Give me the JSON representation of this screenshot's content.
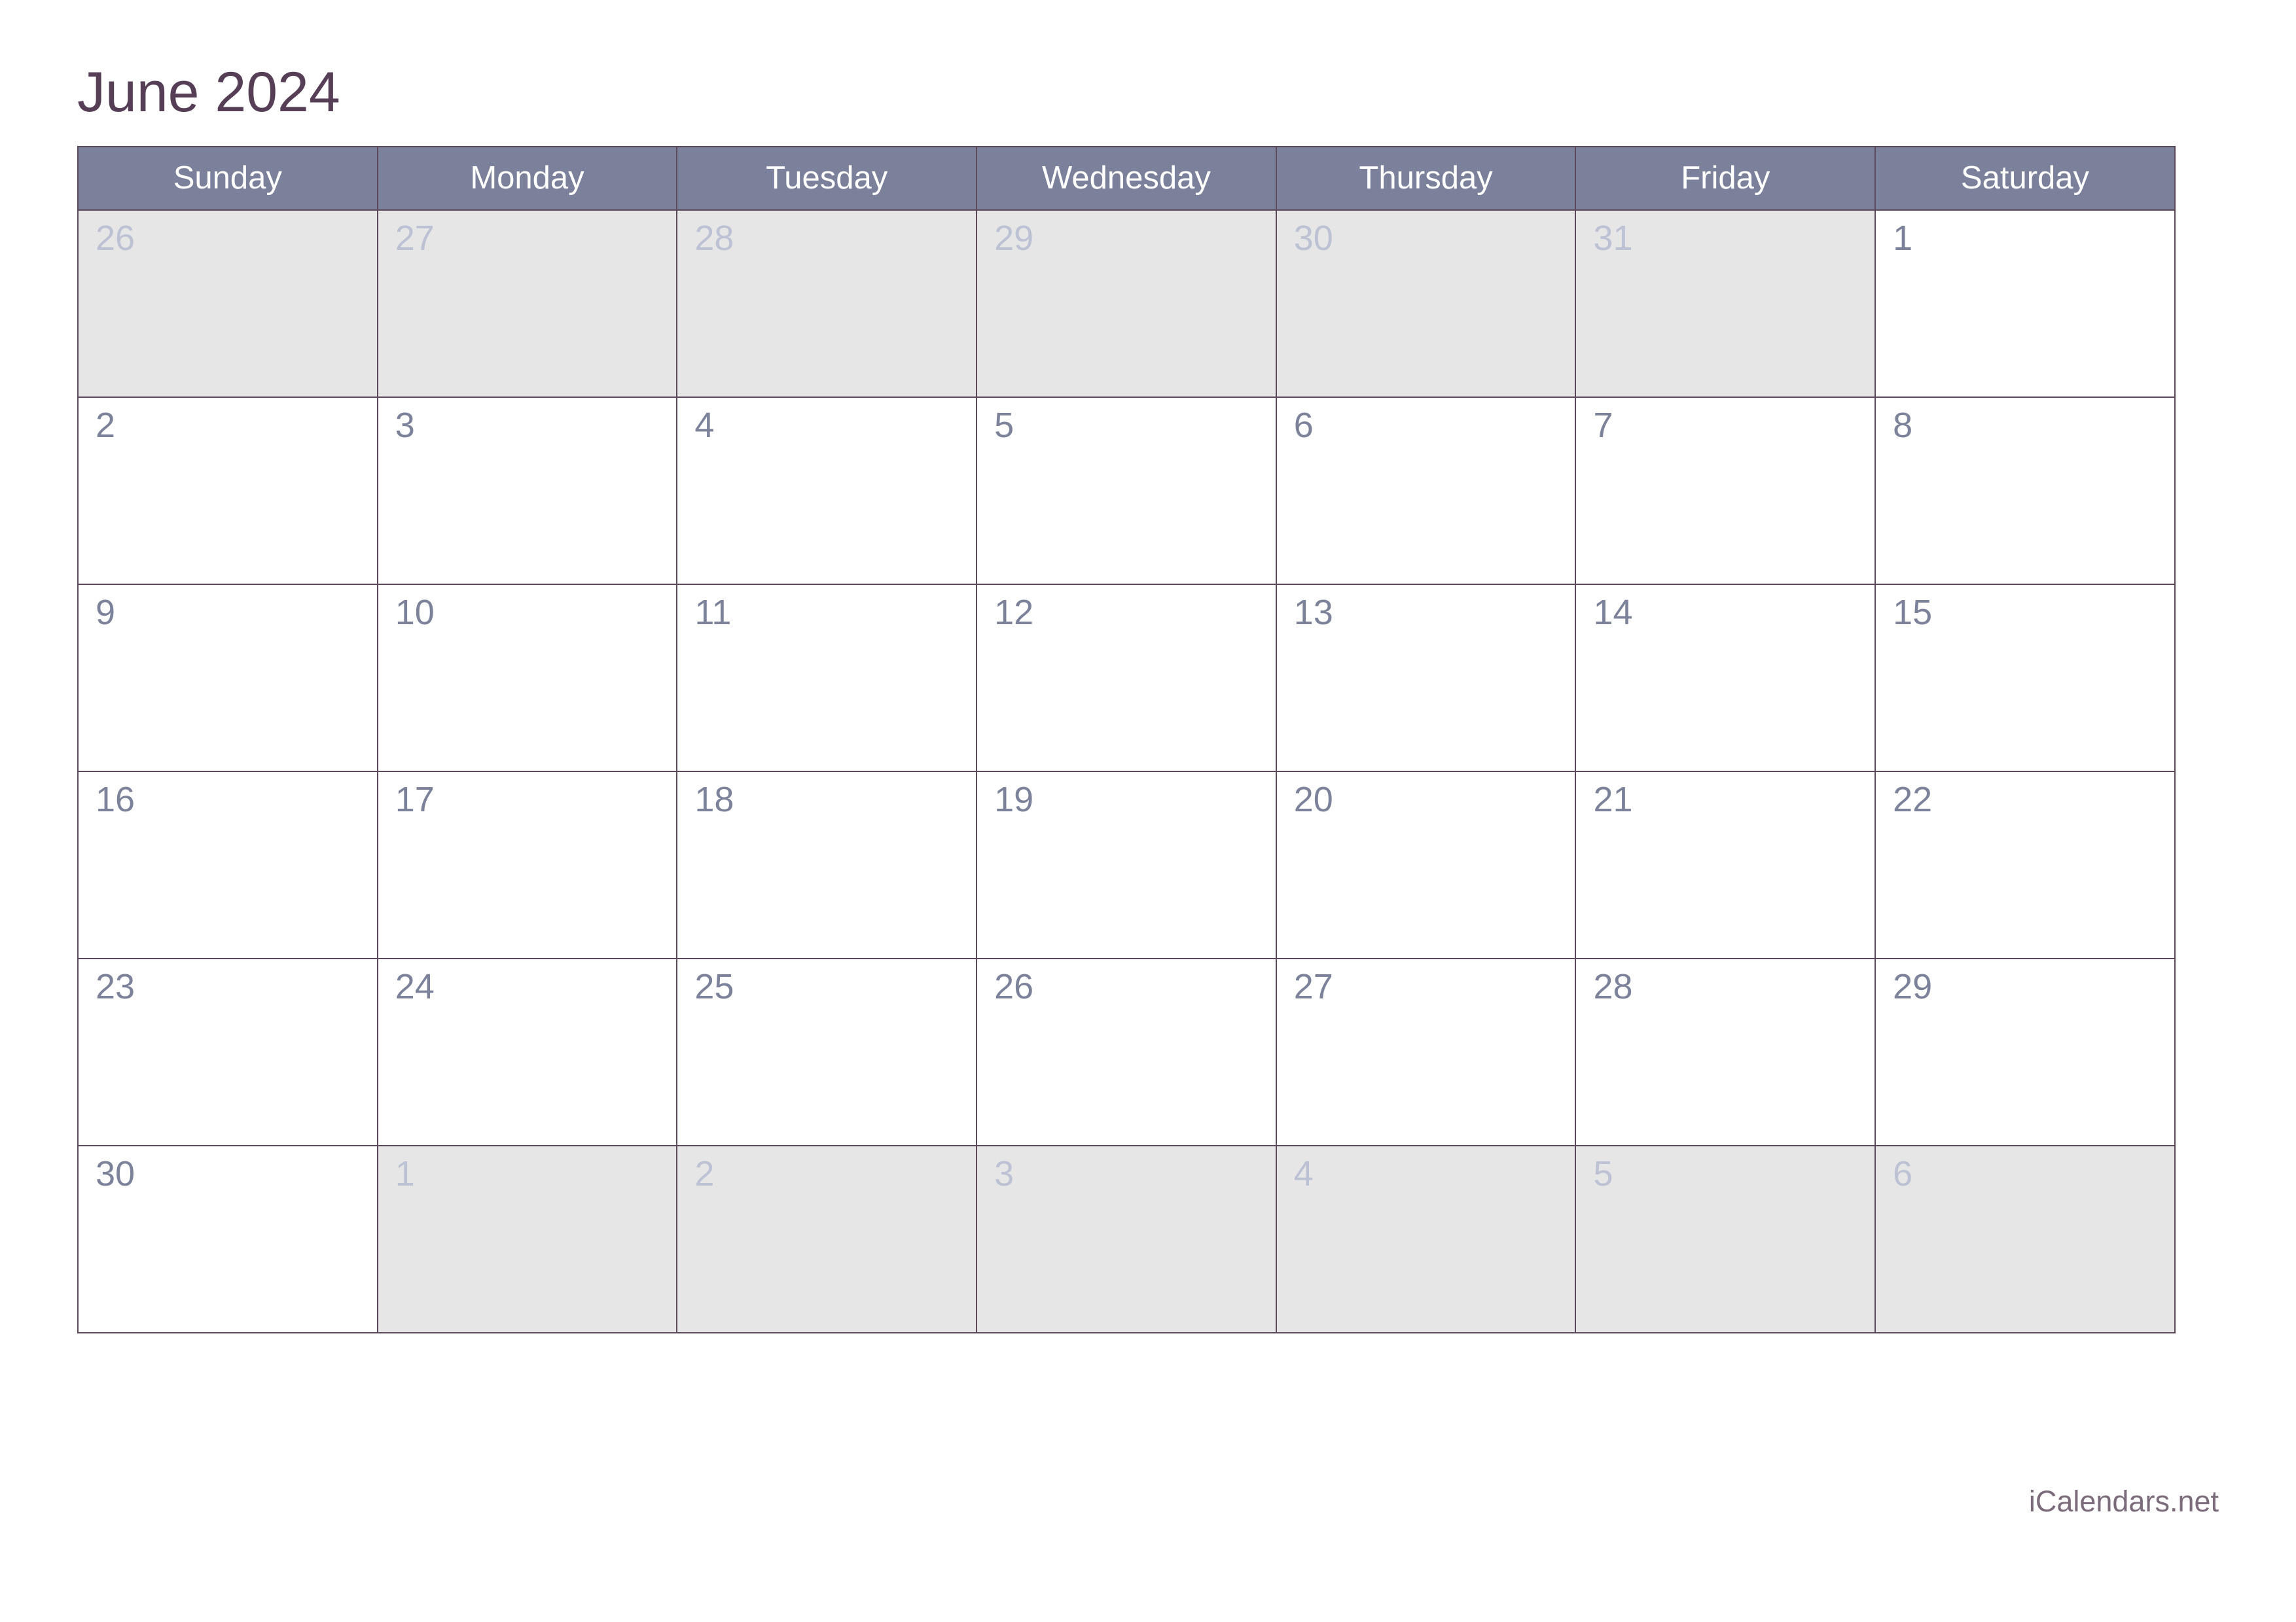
{
  "title": "June 2024",
  "colors": {
    "title_text": "#563f56",
    "header_bg": "#7c819b",
    "header_text": "#ffffff",
    "grid_border": "#5c4a5c",
    "in_month_cell_bg": "#ffffff",
    "in_month_date_text": "#7c829a",
    "adjacent_cell_bg": "#e6e6e6",
    "adjacent_date_text": "#bcc2d4",
    "footer_text": "#7b6b7b"
  },
  "weekdays": [
    "Sunday",
    "Monday",
    "Tuesday",
    "Wednesday",
    "Thursday",
    "Friday",
    "Saturday"
  ],
  "weeks": [
    [
      {
        "day": "26",
        "in_month": false
      },
      {
        "day": "27",
        "in_month": false
      },
      {
        "day": "28",
        "in_month": false
      },
      {
        "day": "29",
        "in_month": false
      },
      {
        "day": "30",
        "in_month": false
      },
      {
        "day": "31",
        "in_month": false
      },
      {
        "day": "1",
        "in_month": true
      }
    ],
    [
      {
        "day": "2",
        "in_month": true
      },
      {
        "day": "3",
        "in_month": true
      },
      {
        "day": "4",
        "in_month": true
      },
      {
        "day": "5",
        "in_month": true
      },
      {
        "day": "6",
        "in_month": true
      },
      {
        "day": "7",
        "in_month": true
      },
      {
        "day": "8",
        "in_month": true
      }
    ],
    [
      {
        "day": "9",
        "in_month": true
      },
      {
        "day": "10",
        "in_month": true
      },
      {
        "day": "11",
        "in_month": true
      },
      {
        "day": "12",
        "in_month": true
      },
      {
        "day": "13",
        "in_month": true
      },
      {
        "day": "14",
        "in_month": true
      },
      {
        "day": "15",
        "in_month": true
      }
    ],
    [
      {
        "day": "16",
        "in_month": true
      },
      {
        "day": "17",
        "in_month": true
      },
      {
        "day": "18",
        "in_month": true
      },
      {
        "day": "19",
        "in_month": true
      },
      {
        "day": "20",
        "in_month": true
      },
      {
        "day": "21",
        "in_month": true
      },
      {
        "day": "22",
        "in_month": true
      }
    ],
    [
      {
        "day": "23",
        "in_month": true
      },
      {
        "day": "24",
        "in_month": true
      },
      {
        "day": "25",
        "in_month": true
      },
      {
        "day": "26",
        "in_month": true
      },
      {
        "day": "27",
        "in_month": true
      },
      {
        "day": "28",
        "in_month": true
      },
      {
        "day": "29",
        "in_month": true
      }
    ],
    [
      {
        "day": "30",
        "in_month": true
      },
      {
        "day": "1",
        "in_month": false
      },
      {
        "day": "2",
        "in_month": false
      },
      {
        "day": "3",
        "in_month": false
      },
      {
        "day": "4",
        "in_month": false
      },
      {
        "day": "5",
        "in_month": false
      },
      {
        "day": "6",
        "in_month": false
      }
    ]
  ],
  "footer": {
    "credit": "iCalendars.net"
  }
}
